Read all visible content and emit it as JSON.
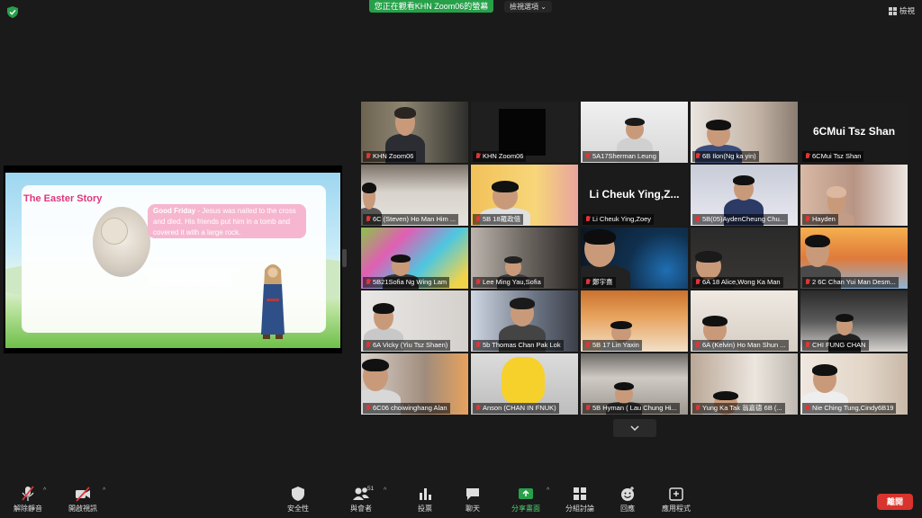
{
  "top_bar": {
    "viewing_banner": "您正在觀看KHN Zoom06的螢幕",
    "view_options": "檢視選項 ⌄",
    "view_button": "檢視"
  },
  "slide": {
    "title": "The Easter Story",
    "bubble_heading": "Good Friday",
    "bubble_text": " - Jesus was nailed to the cross and died. His friends put him in a tomb and covered it with a large rock."
  },
  "participants": [
    {
      "name": "KHN Zoom06",
      "display": "",
      "speaking": true
    },
    {
      "name": "KHN Zoom06",
      "display": ""
    },
    {
      "name": "5A17Sherman Leung",
      "display": ""
    },
    {
      "name": "6B Ilon(Ng ka yin)",
      "display": ""
    },
    {
      "name": "6CMui  Tsz  Shan",
      "display": "6CMui  Tsz  Shan"
    },
    {
      "name": "6C (Steven) Ho Man Him ...",
      "display": ""
    },
    {
      "name": "5B 18羅政僖",
      "display": ""
    },
    {
      "name": "Li Cheuk Ying,Zoey",
      "display": "Li Cheuk Ying,Z..."
    },
    {
      "name": "5B(05)AydenCheung Chu...",
      "display": ""
    },
    {
      "name": "Hayden",
      "display": ""
    },
    {
      "name": "5B21Sofia Ng Wing Lam",
      "display": ""
    },
    {
      "name": "Lee Ming Yau,Sofia",
      "display": ""
    },
    {
      "name": "鄭宇熹",
      "display": ""
    },
    {
      "name": "6A 18 Alice,Wong Ka Man",
      "display": ""
    },
    {
      "name": "2 6C Chan Yui Man Desm...",
      "display": ""
    },
    {
      "name": "6A Vicky (Yiu Tsz Shaen)",
      "display": ""
    },
    {
      "name": "5b Thomas Chan Pak Lok",
      "display": ""
    },
    {
      "name": "5B 17 Lin Yaxin",
      "display": ""
    },
    {
      "name": "6A (Kelvin) Ho Man Shun ...",
      "display": ""
    },
    {
      "name": "CHI FUNG CHAN",
      "display": ""
    },
    {
      "name": "6C06 choiwinghang Alan",
      "display": ""
    },
    {
      "name": "Anson (CHAN IN FNUK)",
      "display": ""
    },
    {
      "name": "5B Hyman ( Lau Chung Hi...",
      "display": ""
    },
    {
      "name": "Yung Ka Tak 翁嘉德 6B (...",
      "display": ""
    },
    {
      "name": "Nie Ching Tung,Cindy6B19",
      "display": ""
    }
  ],
  "toolbar": {
    "unmute": "解除靜音",
    "start_video": "開啟視訊",
    "security": "安全性",
    "participants": "與會者",
    "participants_count": "51",
    "polls": "投票",
    "chat": "聊天",
    "share_screen": "分享畫面",
    "breakout": "分組討論",
    "reactions": "回應",
    "apps": "應用程式",
    "leave": "離開"
  },
  "colors": {
    "banner": "#27a04a",
    "speaker_outline": "#b9e04f",
    "muted_icon": "#e03535",
    "leave": "#d8332c",
    "share_green": "#4fcf73"
  }
}
